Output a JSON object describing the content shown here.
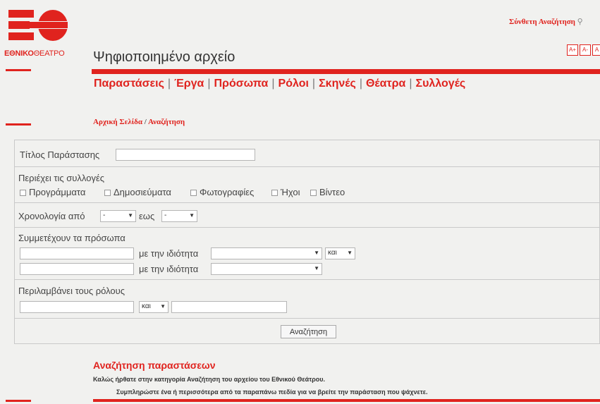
{
  "logo": {
    "brand_bold": "ΕΘΝΙΚΟ",
    "brand_light": "ΘΕΑΤΡΟ",
    "brand_color": "#e0231e"
  },
  "header": {
    "archive_title": "Ψηφιοποιημένο αρχείο",
    "advanced_search": "Σύνθετη Αναζήτηση",
    "search_icon": "magnifier-icon",
    "font_controls": [
      "A+",
      "A-",
      "A"
    ]
  },
  "nav": {
    "items": [
      "Παραστάσεις",
      "Έργα",
      "Πρόσωπα",
      "Ρόλοι",
      "Σκηνές",
      "Θέατρα",
      "Συλλογές"
    ],
    "separator": "|"
  },
  "breadcrumb": {
    "home": "Αρχική Σελίδα",
    "separator": "/",
    "current": "Αναζήτηση"
  },
  "form": {
    "title_label": "Τίτλος Παράστασης",
    "title_value": "",
    "collections_label": "Περιέχει τις συλλογές",
    "collections": [
      "Προγράμματα",
      "Δημοσιεύματα",
      "Φωτογραφίες",
      "Ήχοι",
      "Βίντεο"
    ],
    "year_from_label": "Χρονολογία από",
    "year_from_value": "-",
    "year_to_label": "εως",
    "year_to_value": "-",
    "persons_label": "Συμμετέχουν τα πρόσωπα",
    "role_capacity_label": "με την ιδιότητα",
    "person_1_value": "",
    "person_2_value": "",
    "capacity_1_value": "",
    "capacity_2_value": "",
    "operator_1": "και",
    "roles_label": "Περιλαμβάνει τους ρόλους",
    "role_1_value": "",
    "role_operator": "και",
    "role_2_value": "",
    "submit_label": "Αναζήτηση"
  },
  "info": {
    "title": "Αναζήτηση παραστάσεων",
    "line1": "Καλώς ήρθατε στην κατηγορία Αναζήτηση του αρχείου του Εθνικού Θεάτρου.",
    "line2": "Συμπληρώστε ένα ή περισσότερα από τα παραπάνω πεδία για να βρείτε την παράσταση που ψάχνετε."
  }
}
